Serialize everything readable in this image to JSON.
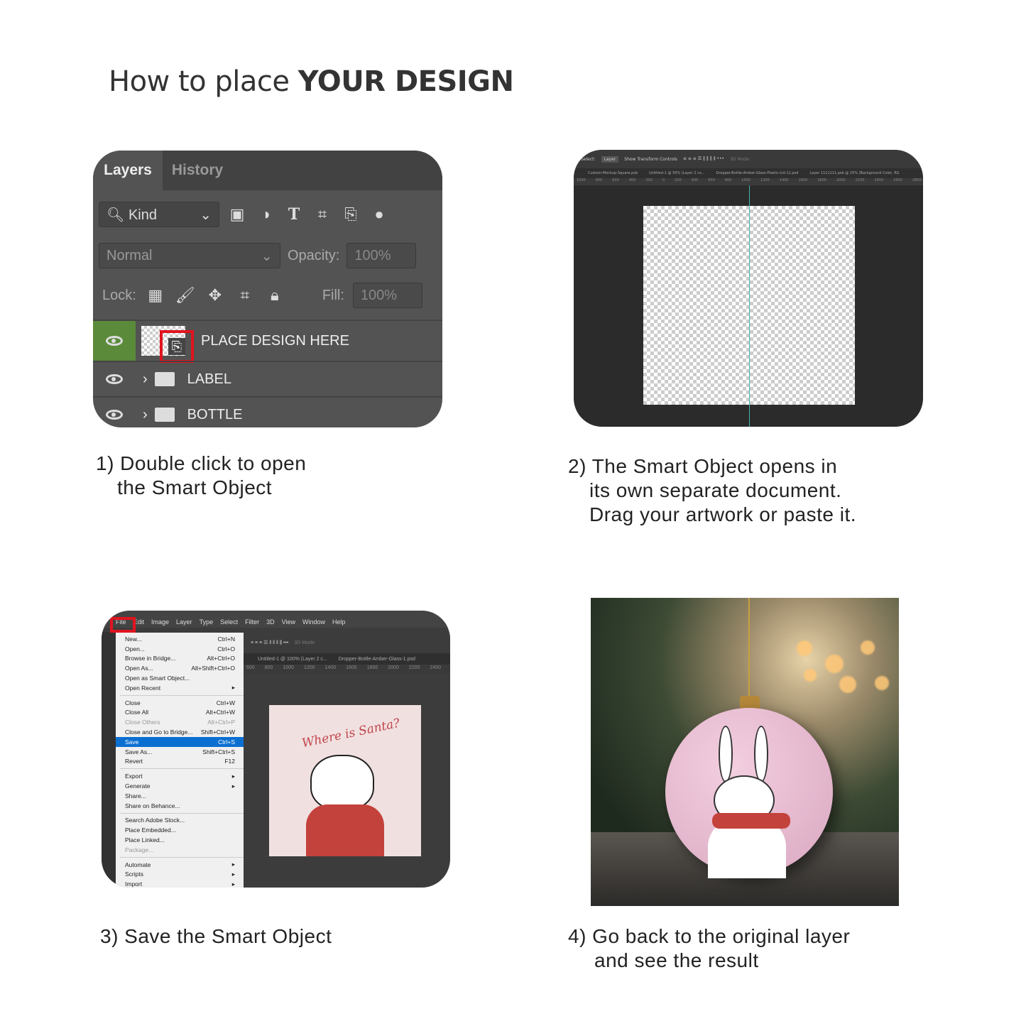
{
  "title": {
    "normal": "How to place ",
    "bold": "YOUR DESIGN"
  },
  "step1": {
    "caption_line1": "1) Double click to open",
    "caption_line2": "the Smart Object",
    "tabs": [
      "Layers",
      "History"
    ],
    "filter": {
      "label": "Kind"
    },
    "blend_mode": "Normal",
    "opacity_label": "Opacity:",
    "opacity_value": "100%",
    "lock_label": "Lock:",
    "fill_label": "Fill:",
    "fill_value": "100%",
    "layers": [
      {
        "name": "PLACE DESIGN HERE",
        "selected": true
      },
      {
        "name": "LABEL",
        "type": "group"
      },
      {
        "name": "BOTTLE",
        "type": "group"
      }
    ],
    "highlight_color": "#e0141e",
    "selected_layer_color": "#5a8a3a"
  },
  "step2": {
    "caption_line1": "2) The Smart Object opens in",
    "caption_line2": "its own separate document.",
    "caption_line3": "Drag your artwork or paste it.",
    "toolbar": {
      "select_label": "Select:",
      "select_value": "Layer",
      "transform": "Show Transform Controls",
      "mode": "3D Mode:"
    },
    "doc_tabs": [
      "Custom-Mockup-Square.psb",
      "Untitled-1 @ 50% (Layer 2 co...",
      "Dropper-Bottle-Amber-Glass-Plastic-Lid-11.psd",
      "Layer 1111111.psb @ 25% (Background Color, RG"
    ],
    "ruler": [
      "1000",
      "800",
      "600",
      "400",
      "200",
      "0",
      "200",
      "400",
      "600",
      "800",
      "1000",
      "1200",
      "1400",
      "1600",
      "1800",
      "2000",
      "2200",
      "2400",
      "2600",
      "2800",
      "3000",
      "3200",
      "3400",
      "3600",
      "3800"
    ]
  },
  "step3": {
    "caption": "3) Save the Smart Object",
    "menubar": [
      "File",
      "Edit",
      "Image",
      "Layer",
      "Type",
      "Select",
      "Filter",
      "3D",
      "View",
      "Window",
      "Help"
    ],
    "menu_groups": [
      [
        {
          "label": "New...",
          "shortcut": "Ctrl+N"
        },
        {
          "label": "Open...",
          "shortcut": "Ctrl+O"
        },
        {
          "label": "Browse in Bridge...",
          "shortcut": "Alt+Ctrl+O"
        },
        {
          "label": "Open As...",
          "shortcut": "Alt+Shift+Ctrl+O"
        },
        {
          "label": "Open as Smart Object...",
          "shortcut": ""
        },
        {
          "label": "Open Recent",
          "shortcut": "▸"
        }
      ],
      [
        {
          "label": "Close",
          "shortcut": "Ctrl+W"
        },
        {
          "label": "Close All",
          "shortcut": "Alt+Ctrl+W"
        },
        {
          "label": "Close Others",
          "shortcut": "Alt+Ctrl+P",
          "disabled": true
        },
        {
          "label": "Close and Go to Bridge...",
          "shortcut": "Shift+Ctrl+W"
        },
        {
          "label": "Save",
          "shortcut": "Ctrl+S",
          "highlighted": true
        },
        {
          "label": "Save As...",
          "shortcut": "Shift+Ctrl+S"
        },
        {
          "label": "Revert",
          "shortcut": "F12"
        }
      ],
      [
        {
          "label": "Export",
          "shortcut": "▸"
        },
        {
          "label": "Generate",
          "shortcut": "▸"
        },
        {
          "label": "Share...",
          "shortcut": ""
        },
        {
          "label": "Share on Behance...",
          "shortcut": ""
        }
      ],
      [
        {
          "label": "Search Adobe Stock...",
          "shortcut": ""
        },
        {
          "label": "Place Embedded...",
          "shortcut": ""
        },
        {
          "label": "Place Linked...",
          "shortcut": ""
        },
        {
          "label": "Package...",
          "shortcut": "",
          "disabled": true
        }
      ],
      [
        {
          "label": "Automate",
          "shortcut": "▸"
        },
        {
          "label": "Scripts",
          "shortcut": "▸"
        },
        {
          "label": "Import",
          "shortcut": "▸"
        }
      ]
    ],
    "toolbar_mode": "3D Mode:",
    "doc_tabs": [
      "Untitled-1 @ 100% (Layer 2 c...",
      "Dropper-Bottle-Amber-Glass-1.psd"
    ],
    "ruler": [
      "600",
      "800",
      "1000",
      "1200",
      "1400",
      "1600",
      "1800",
      "2000",
      "2200",
      "2400"
    ],
    "artwork_text": "Where is Santa?"
  },
  "step4": {
    "caption_line1": "4) Go back to the original layer",
    "caption_line2": "and see the result"
  }
}
